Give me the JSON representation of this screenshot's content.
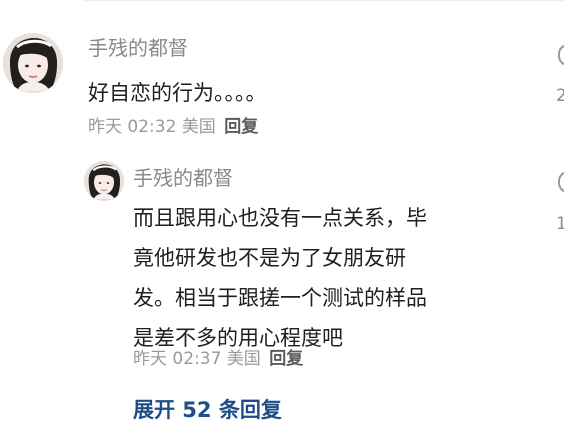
{
  "main_comment": {
    "username": "手残的都督",
    "text": "好自恋的行为。。。。",
    "time": "昨天 02:32",
    "location": "美国",
    "reply_label": "回复"
  },
  "reply_comment": {
    "username": "手残的都督",
    "lines": [
      "而且跟用心也没有一点关系，毕",
      "竟他研发也不是为了女朋友研",
      "发。相当于跟搓一个测试的样品",
      "是差不多的用心程度吧"
    ],
    "time": "昨天 02:37",
    "location": "美国",
    "reply_label": "回复"
  },
  "expand_replies_label": "展开 52 条回复",
  "edge_fragments": {
    "number_1": "2",
    "number_2": "1"
  },
  "colors": {
    "link": "#1f4d8a",
    "meta": "#9a9a9a",
    "username": "#8a8a8a"
  }
}
